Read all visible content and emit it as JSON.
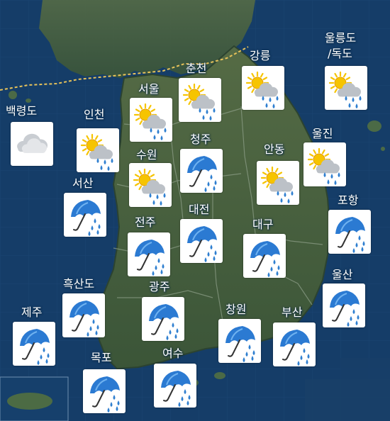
{
  "colors": {
    "sea": "#143a63",
    "land": "#3f5b3a",
    "card": "#ffffff",
    "rain": "#2f7fd0",
    "sun": "#f6c400",
    "boundary": "#e8c35a"
  },
  "regions": [
    {
      "id": "baengnyeongdo",
      "label": "백령도",
      "weather": "cloudy"
    },
    {
      "id": "incheon",
      "label": "인천",
      "weather": "partly-cloudy-rain"
    },
    {
      "id": "seoul",
      "label": "서울",
      "weather": "partly-cloudy-rain"
    },
    {
      "id": "chuncheon",
      "label": "춘천",
      "weather": "partly-cloudy-rain"
    },
    {
      "id": "gangneung",
      "label": "강릉",
      "weather": "partly-cloudy-rain"
    },
    {
      "id": "ulleungdo",
      "label": "울릉도",
      "weather": "partly-cloudy-rain"
    },
    {
      "id": "dokdo",
      "label": "/독도",
      "weather": "partly-cloudy-rain"
    },
    {
      "id": "suwon",
      "label": "수원",
      "weather": "partly-cloudy-rain"
    },
    {
      "id": "cheongju",
      "label": "청주",
      "weather": "rain"
    },
    {
      "id": "andong",
      "label": "안동",
      "weather": "partly-cloudy-rain"
    },
    {
      "id": "uljin",
      "label": "울진",
      "weather": "partly-cloudy-rain"
    },
    {
      "id": "seosan",
      "label": "서산",
      "weather": "rain"
    },
    {
      "id": "pohang",
      "label": "포항",
      "weather": "rain"
    },
    {
      "id": "jeonju",
      "label": "전주",
      "weather": "rain"
    },
    {
      "id": "daejeon",
      "label": "대전",
      "weather": "rain"
    },
    {
      "id": "daegu",
      "label": "대구",
      "weather": "rain"
    },
    {
      "id": "heuksando",
      "label": "흑산도",
      "weather": "rain"
    },
    {
      "id": "gwangju",
      "label": "광주",
      "weather": "rain"
    },
    {
      "id": "ulsan",
      "label": "울산",
      "weather": "rain"
    },
    {
      "id": "jeju",
      "label": "제주",
      "weather": "rain"
    },
    {
      "id": "changwon",
      "label": "창원",
      "weather": "rain"
    },
    {
      "id": "busan",
      "label": "부산",
      "weather": "rain"
    },
    {
      "id": "mokpo",
      "label": "목포",
      "weather": "rain"
    },
    {
      "id": "yeosu",
      "label": "여수",
      "weather": "rain"
    }
  ]
}
